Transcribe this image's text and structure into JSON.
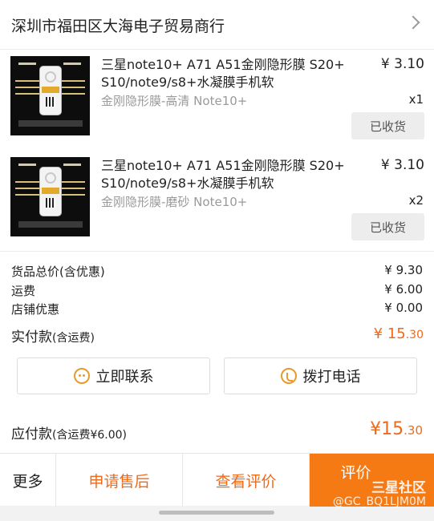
{
  "shop": {
    "name": "深圳市福田区大海电子贸易商行"
  },
  "products": [
    {
      "title": "三星note10+ A71 A51金刚隐形膜 S20+ S10/note9/s8+水凝膜手机软",
      "price": "¥ 3.10",
      "spec": "金刚隐形膜-高清 Note10+",
      "qty": "x1",
      "status": "已收货"
    },
    {
      "title": "三星note10+ A71 A51金刚隐形膜 S20+ S10/note9/s8+水凝膜手机软",
      "price": "¥ 3.10",
      "spec": "金刚隐形膜-磨砂 Note10+",
      "qty": "x2",
      "status": "已收货"
    }
  ],
  "summary": {
    "goods_total_label": "货品总价(含优惠)",
    "goods_total_value": "¥ 9.30",
    "shipping_label": "运费",
    "shipping_value": "¥ 6.00",
    "discount_label": "店铺优惠",
    "discount_value": "¥ 0.00",
    "paid_label": "实付款",
    "paid_sub": "(含运费)",
    "paid_symbol": "¥ 15",
    "paid_decimal": ".30"
  },
  "actions": {
    "contact": "立即联系",
    "call": "拨打电话"
  },
  "payable": {
    "label": "应付款",
    "sub": "(含运费¥6.00)",
    "symbol": "¥15",
    "decimal": ".30"
  },
  "bottom": {
    "more": "更多",
    "after_sale": "申请售后",
    "view_review": "查看评价",
    "rate": "评价"
  },
  "watermark": {
    "line1": "三星社区",
    "line2": "@GC_BQ1LJM0M"
  },
  "colors": {
    "accent": "#f57a14",
    "price_accent": "#ee6a1b"
  }
}
